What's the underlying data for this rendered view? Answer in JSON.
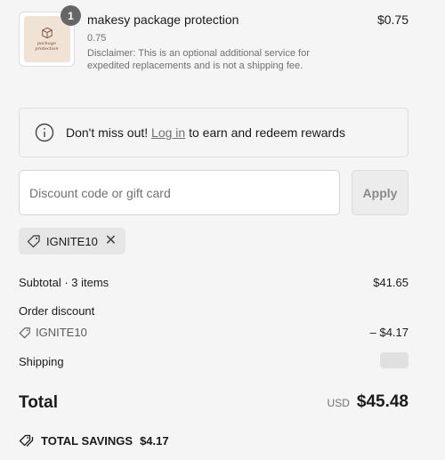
{
  "line_item": {
    "thumbnail_text": "package\nprotection",
    "quantity": "1",
    "name": "makesy package protection",
    "variant": "0.75",
    "description": "Disclaimer: This is an optional additional service for expedited replacements and is not a shipping fee.",
    "price": "$0.75"
  },
  "rewards": {
    "prefix": "Don't miss out! ",
    "link": "Log in",
    "suffix": " to earn and redeem rewards"
  },
  "discount": {
    "placeholder": "Discount code or gift card",
    "apply_label": "Apply",
    "applied_code": "IGNITE10"
  },
  "summary": {
    "subtotal_label": "Subtotal · 3 items",
    "subtotal_value": "$41.65",
    "order_discount_label": "Order discount",
    "order_discount_code": "IGNITE10",
    "order_discount_value": "– $4.17",
    "shipping_label": "Shipping",
    "total_label": "Total",
    "currency": "USD",
    "total_value": "$45.48",
    "savings_label": "TOTAL SAVINGS",
    "savings_value": "$4.17"
  },
  "icons": {
    "info": "info-icon",
    "tag": "tag-icon",
    "close": "close-icon",
    "savings": "double-tag-icon"
  }
}
